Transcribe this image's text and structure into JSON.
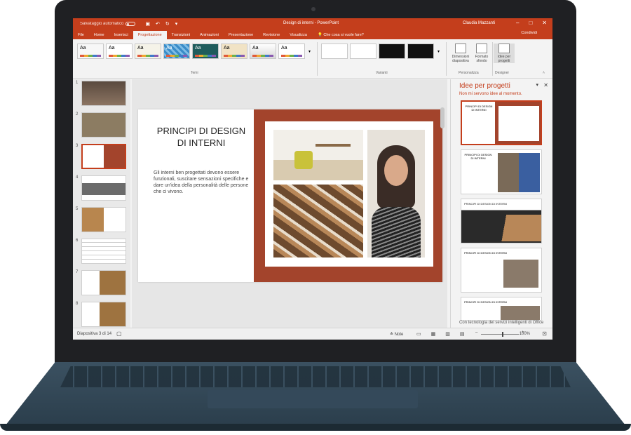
{
  "window": {
    "autosave_label": "Salvataggio automatico",
    "title": "Design di interni - PowerPoint",
    "user": "Claudia Mazzanti",
    "share_label": "Condividi"
  },
  "tabs": [
    "File",
    "Home",
    "Inserisci",
    "Progettazione",
    "Transizioni",
    "Animazioni",
    "Presentazione",
    "Revisione",
    "Visualizza"
  ],
  "active_tab": "Progettazione",
  "tell_me": "Che cosa si vuole fare?",
  "ribbon": {
    "themes_label": "Temi",
    "theme_glyph": "Aa",
    "variants_label": "Varianti",
    "customize_label": "Personalizza",
    "designer_label": "Designer",
    "slide_size_label": "Dimensioni diapositiva",
    "format_bg_label": "Formato sfondo",
    "design_ideas_btn": "Idee per progetti"
  },
  "thumbnails": [
    "1",
    "2",
    "3",
    "4",
    "5",
    "6",
    "7",
    "8"
  ],
  "selected_thumbnail": "3",
  "slide": {
    "title": "PRINCIPI DI DESIGN DI INTERNI",
    "body": "Gli interni ben progettati devono essere funzionali, suscitare sensazioni specifiche e dare un'idea della personalità delle persone che ci vivono.",
    "accent": "#a3442c"
  },
  "pane": {
    "title": "Idee per progetti",
    "dismiss_link": "Non mi servono idee al momento.",
    "footer": "Con tecnologia dei servizi intelligenti di Office",
    "idea_title": "PRINCIPI DI DESIGN DI INTERNI"
  },
  "status": {
    "slide_counter": "Diapositiva 3 di 14",
    "notes_label": "Note",
    "zoom": "100%"
  },
  "colors": {
    "brand": "#c43e1c",
    "laptop": "#2b3e4c"
  }
}
